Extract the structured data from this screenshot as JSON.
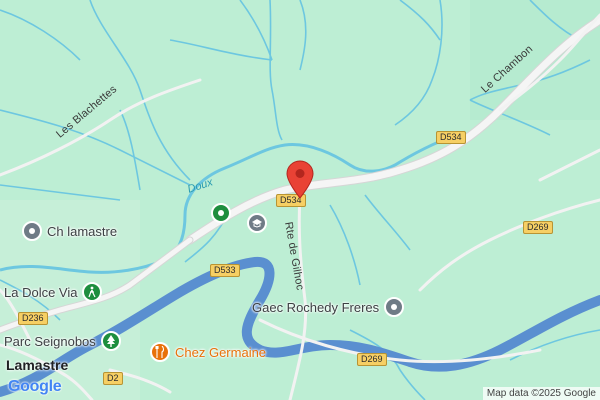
{
  "colors": {
    "land": "#bdeed4",
    "water": "#6dc7e0",
    "river_wide": "#5a8fd0",
    "road": "#f5f5f5",
    "road_outline": "#d6d6d6",
    "marker": "#e94235",
    "poi_green": "#1e8e3e",
    "poi_gray": "#6f7b86",
    "poi_orange": "#e8710a",
    "shield": "#f6cf64"
  },
  "roads": {
    "les_blachettes": "Les Blachettes",
    "le_chambon": "Le Chambon",
    "rte_de_gilhoc": "Rte de Gilhoc"
  },
  "shields": {
    "d534_main": "D534",
    "d534_east": "D534",
    "d533": "D533",
    "d269_east": "D269",
    "d269_south": "D269",
    "d236": "D236",
    "d2": "D2"
  },
  "river": {
    "doux": "Doux"
  },
  "pois": {
    "ch_lamastre": {
      "label": "Ch lamastre",
      "icon": "pin-icon"
    },
    "la_dolce_via": {
      "label": "La Dolce Via",
      "icon": "hiking-icon"
    },
    "parc_seignobos": {
      "label": "Parc Seignobos",
      "icon": "tree-icon"
    },
    "chez_germaine": {
      "label": "Chez Germaine",
      "icon": "restaurant-icon"
    },
    "gaec_rochedy": {
      "label": "Gaec Rochedy Freres",
      "icon": "pin-icon"
    },
    "unnamed_green": {
      "label": "",
      "icon": "pin-icon"
    },
    "school": {
      "label": "",
      "icon": "school-icon"
    }
  },
  "town": {
    "lamastre": "Lamastre"
  },
  "branding": {
    "logo": "Google",
    "attribution": "Map data ©2025 Google"
  },
  "marker": {
    "icon": "location-pin-icon"
  }
}
